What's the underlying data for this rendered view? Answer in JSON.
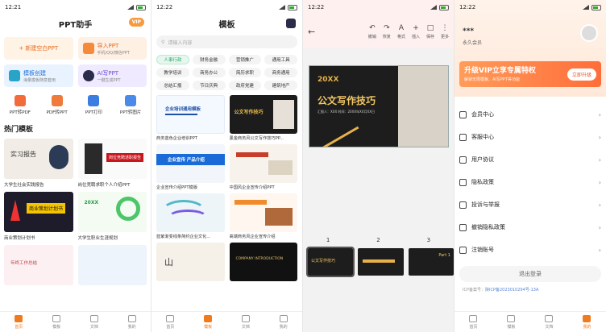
{
  "panel1": {
    "time": "12:21",
    "title": "PPT助手",
    "vip": "VIP",
    "cards": [
      {
        "label": "+ 新建空白PPT",
        "sub": ""
      },
      {
        "label": "导入PPT",
        "sub": "手机/QQ/微信PPT"
      },
      {
        "label": "模板创建",
        "sub": "海量模板随意套用"
      },
      {
        "label": "AI写PPT",
        "sub": "一键生成PPT"
      }
    ],
    "tools": [
      "PPT转PDF",
      "PDF转PPT",
      "PPT打印",
      "PPT转图片"
    ],
    "section": "热门模板",
    "thumbs": [
      {
        "cap": "大学生社会实践报告",
        "text": "实习报告"
      },
      {
        "cap": "岗位竞聘求职个人介绍PPT",
        "text": "岗位竞聘述职报告"
      },
      {
        "cap": "商业策划计划书",
        "text": "商业策划计划书"
      },
      {
        "cap": "大学生职业生涯规划",
        "text": "20XX"
      },
      {
        "cap": "",
        "text": "年终工作总结"
      },
      {
        "cap": "",
        "text": ""
      }
    ]
  },
  "panel2": {
    "time": "12:22",
    "title": "模板",
    "search_placeholder": "请输入内容",
    "chips": [
      "人事行政",
      "财务金融",
      "营销推广",
      "通用工具",
      "教学培训",
      "商务办公",
      "简历求职",
      "商务通用",
      "总结汇报",
      "节日庆典",
      "政府党建",
      "建筑地产"
    ],
    "thumbs": [
      {
        "cap": "商务蓝色企业培训PPT",
        "text": "企业培训通用模板"
      },
      {
        "cap": "黑金商务风公文写作技巧PP...",
        "text": "公文写作技巧"
      },
      {
        "cap": "企业宣传介绍PPT模版",
        "text": "企业宣传 产品介绍"
      },
      {
        "cap": "中国风企业宣传介绍PPT",
        "text": ""
      },
      {
        "cap": "蓝紫渐变线条简约企业文化...",
        "text": ""
      },
      {
        "cap": "高端商务风企业宣传介绍",
        "text": ""
      },
      {
        "cap": "",
        "text": ""
      },
      {
        "cap": "",
        "text": "COMPANY INTRODUCTION"
      }
    ]
  },
  "panel3": {
    "time": "12:22",
    "tools": [
      "撤销",
      "恢复",
      "格式",
      "插入",
      "保存",
      "更多"
    ],
    "slide_year": "20XX",
    "slide_title": "公文写作技巧",
    "slide_sub": "汇报人：XXX   时间：20XX年XX月XX日",
    "page_numbers": [
      "1",
      "2",
      "3"
    ],
    "strip_labels": [
      "公文写作技巧",
      "",
      "Part 1"
    ]
  },
  "panel4": {
    "time": "12:22",
    "user_name": "***",
    "member": "永久会员",
    "vip_title": "升级VIP立享专属特权",
    "vip_sub": "解锁无限模板、AI写PPT等功能",
    "vip_btn": "立即升级",
    "menu": [
      "会员中心",
      "客服中心",
      "用户协议",
      "隐私政策",
      "投诉与举报",
      "撤销隐私政策",
      "注销账号"
    ],
    "logout": "退出登录",
    "icp_label": "ICP备案号：",
    "icp_value": "陕ICP备2023010294号-13A"
  },
  "tabs": [
    "首页",
    "模板",
    "文档",
    "我的"
  ]
}
